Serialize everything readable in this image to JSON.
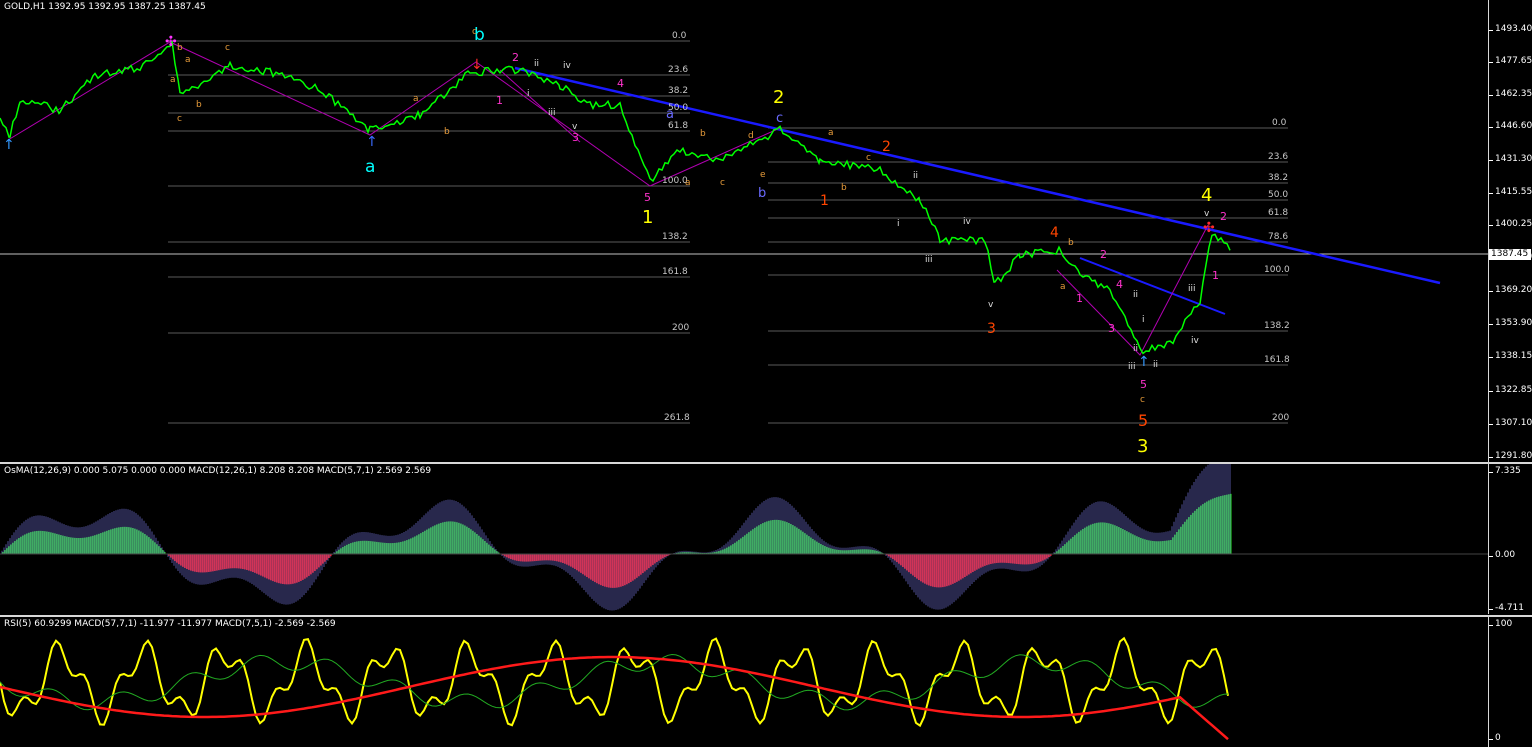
{
  "main": {
    "header": "GOLD,H1  1392.95 1392.95 1387.25 1387.45",
    "price_flag": "1387.45",
    "axis": [
      "1493.40",
      "1477.65",
      "1462.35",
      "1446.60",
      "1431.30",
      "1415.55",
      "1400.25",
      "1384.50",
      "1369.20",
      "1353.90",
      "1338.15",
      "1322.85",
      "1307.10",
      "1291.80"
    ],
    "fib_left": [
      "0.0",
      "23.6",
      "38.2",
      "50.0",
      "61.8",
      "100.0",
      "138.2",
      "161.8",
      "200",
      "261.8"
    ],
    "fib_right": [
      "0.0",
      "23.6",
      "38.2",
      "50.0",
      "61.8",
      "78.6",
      "100.0",
      "138.2",
      "161.8",
      "200"
    ],
    "waves": {
      "a1": "a",
      "b1": "b",
      "c1": "c",
      "d1": "d",
      "e1": "e",
      "n1": "1",
      "n2": "2",
      "n3": "3",
      "n4": "4",
      "n5": "5",
      "r1": "i",
      "r2": "ii",
      "r3": "iii",
      "r4": "iv",
      "r5": "v"
    }
  },
  "osma": {
    "header": "OsMA(12,26,9) 0.000 5.075 0.000 0.000  MACD(12,26,1) 8.208 8.208  MACD(5,7,1) 2.569 2.569",
    "axis": [
      "7.335",
      "0.00",
      "-4.711"
    ]
  },
  "rsi": {
    "header": "RSI(5) 60.9299  MACD(57,7,1) -11.977 -11.977  MACD(7,5,1) -2.569 -2.569",
    "axis": [
      "100",
      "0"
    ]
  },
  "colors": {
    "trend": "#0000ff",
    "yellow": "#ffff00",
    "orange": "#ff4500",
    "magenta": "#ff00ff",
    "cyan": "#00ffff",
    "green": "#00ff00",
    "red": "#ff0000"
  }
}
